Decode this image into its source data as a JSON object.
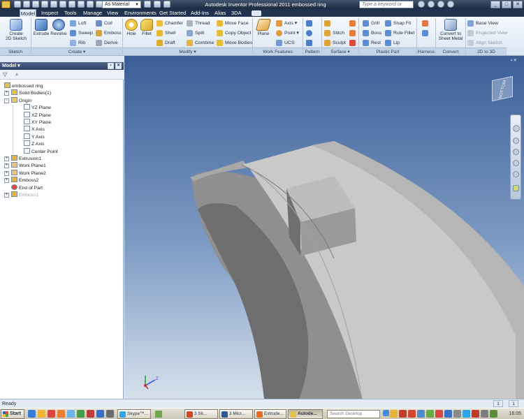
{
  "window": {
    "title": "Autodesk Inventor Professional 2011    embossed ring",
    "material": "As Material",
    "help_placeholder": "Type a keyword or phrase",
    "controls": [
      "_",
      "□",
      "✕"
    ]
  },
  "ribbon": {
    "tabs": [
      "Model",
      "Inspect",
      "Tools",
      "Manage",
      "View",
      "Environments",
      "Get Started",
      "Add-Ins",
      "Alias",
      "3DA"
    ],
    "active_tab": "Model",
    "panels": {
      "sketch": {
        "label": "Sketch",
        "create_2d_sketch": "Create\n2D Sketch"
      },
      "create": {
        "label": "Create ▾",
        "extrude": "Extrude",
        "revolve": "Revolve",
        "loft": "Loft",
        "sweep": "Sweep",
        "rib": "Rib",
        "coil": "Coil",
        "emboss": "Emboss",
        "derive": "Derive"
      },
      "modify": {
        "label": "Modify ▾",
        "hole": "Hole",
        "fillet": "Fillet",
        "chamfer": "Chamfer",
        "shell": "Shell",
        "draft": "Draft",
        "thread": "Thread",
        "split": "Split",
        "combine": "Combine",
        "move_face": "Move Face",
        "copy_object": "Copy Object",
        "move_bodies": "Move Bodies"
      },
      "work_features": {
        "label": "Work Features",
        "plane": "Plane",
        "axis": "Axis ▾",
        "point": "Point ▾",
        "ucs": "UCS"
      },
      "pattern": {
        "label": "Pattern"
      },
      "surface": {
        "label": "Surface ▾",
        "stitch": "Stitch",
        "sculpt": "Sculpt"
      },
      "plastic_part": {
        "label": "Plastic Part",
        "grill": "Grill",
        "boss": "Boss",
        "rest": "Rest",
        "snap_fit": "Snap Fit",
        "rule_fillet": "Rule Fillet",
        "lip": "Lip"
      },
      "harness": {
        "label": "Harness"
      },
      "convert": {
        "label": "Convert",
        "convert_sheet_metal": "Convert to\nSheet Metal"
      },
      "two_d_to_three_d": {
        "label": "2D to 3D",
        "base_view": "Base View",
        "projected_view": "Projected View",
        "align_sketch": "Align Sketch"
      }
    }
  },
  "browser": {
    "title": "Model ▾",
    "tree": [
      {
        "label": "embossed ring",
        "depth": 0,
        "icon": "part-icon"
      },
      {
        "label": "Solid Bodies(1)",
        "depth": 1,
        "expand": "+",
        "icon": "solid-bodies-icon"
      },
      {
        "label": "Origin",
        "depth": 1,
        "expand": "-",
        "icon": "folder-icon"
      },
      {
        "label": "YZ Plane",
        "depth": 2,
        "icon": "plane-icon"
      },
      {
        "label": "XZ Plane",
        "depth": 2,
        "icon": "plane-icon"
      },
      {
        "label": "XY Plane",
        "depth": 2,
        "icon": "plane-icon"
      },
      {
        "label": "X Axis",
        "depth": 2,
        "icon": "axis-icon"
      },
      {
        "label": "Y Axis",
        "depth": 2,
        "icon": "axis-icon"
      },
      {
        "label": "Z Axis",
        "depth": 2,
        "icon": "axis-icon"
      },
      {
        "label": "Center Point",
        "depth": 2,
        "icon": "point-icon"
      },
      {
        "label": "Extrusion1",
        "depth": 1,
        "expand": "+",
        "icon": "extrusion-icon"
      },
      {
        "label": "Work Plane1",
        "depth": 1,
        "expand": "+",
        "icon": "work-plane-icon"
      },
      {
        "label": "Work Plane2",
        "depth": 1,
        "expand": "+",
        "icon": "work-plane-icon"
      },
      {
        "label": "Emboss2",
        "depth": 1,
        "expand": "+",
        "icon": "emboss-icon"
      },
      {
        "label": "End of Part",
        "depth": 1,
        "icon": "end-of-part-icon"
      },
      {
        "label": "Emboss1",
        "depth": 1,
        "expand": "+",
        "icon": "emboss-icon",
        "dim": true
      }
    ]
  },
  "viewport": {
    "viewcube_label": "BOTTOM",
    "triad": {
      "x": "X",
      "y": "Y",
      "z": "Z"
    }
  },
  "status": {
    "text": "Ready",
    "cells": [
      "1",
      "1"
    ]
  },
  "taskbar": {
    "start": "Start",
    "buttons": [
      {
        "label": "Skype™...",
        "active": false
      },
      {
        "label": "3 Sli...",
        "active": false
      },
      {
        "label": "3 Micr...",
        "active": false
      },
      {
        "label": "Extrude...",
        "active": false
      },
      {
        "label": "Autode...",
        "active": true
      }
    ],
    "search_placeholder": "Search Desktop",
    "clock": "16:05"
  },
  "colors": {
    "viewport_top": "#3b5e96",
    "viewport_bottom": "#d6e0ec",
    "model_gray": "#8c8c8c",
    "ribbon_tab_bg": "#20324d"
  }
}
